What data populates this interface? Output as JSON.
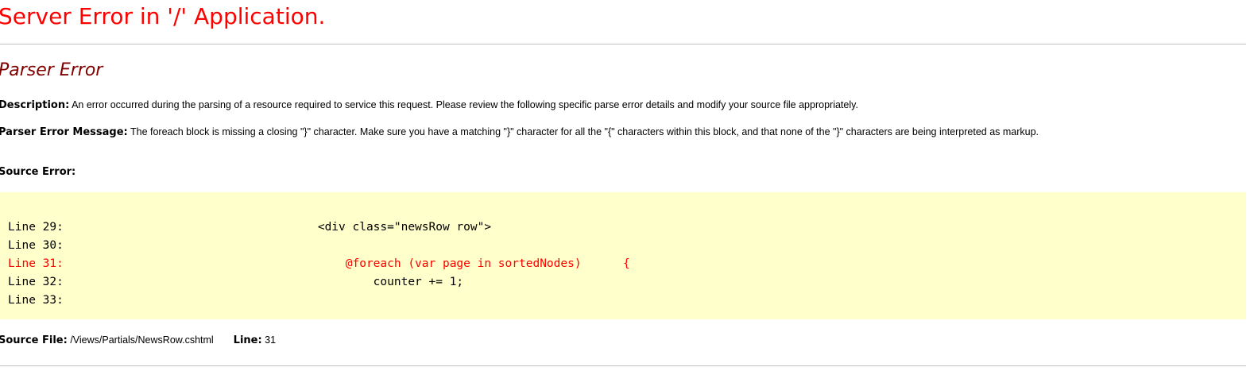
{
  "page_title": "Server Error in '/' Application.",
  "error_type": "Parser Error",
  "description": {
    "label": "Description:",
    "text": "An error occurred during the parsing of a resource required to service this request. Please review the following specific parse error details and modify your source file appropriately."
  },
  "parser_error_message": {
    "label": "Parser Error Message:",
    "text": "The foreach block is missing a closing \"}\" character.  Make sure you have a matching \"}\" character for all the \"{\" characters within this block, and that none of the \"}\" characters are being interpreted as markup."
  },
  "source_error": {
    "label": "Source Error:",
    "lines": [
      {
        "number": "Line 29:",
        "code": "        <div class=\"newsRow row\">",
        "is_error": false
      },
      {
        "number": "Line 30:",
        "code": "",
        "is_error": false
      },
      {
        "number": "Line 31:",
        "code": "            @foreach (var page in sortedNodes)      {",
        "is_error": true
      },
      {
        "number": "Line 32:",
        "code": "                counter += 1;",
        "is_error": false
      },
      {
        "number": "Line 33:",
        "code": "",
        "is_error": false
      }
    ]
  },
  "source_file": {
    "label": "Source File:",
    "value": "/Views/Partials/NewsRow.cshtml",
    "line_label": "Line:",
    "line_value": "31"
  },
  "colors": {
    "title": "#ff0000",
    "subtitle": "#800000",
    "code_background": "#ffffcc",
    "error_line": "#ff0000"
  }
}
